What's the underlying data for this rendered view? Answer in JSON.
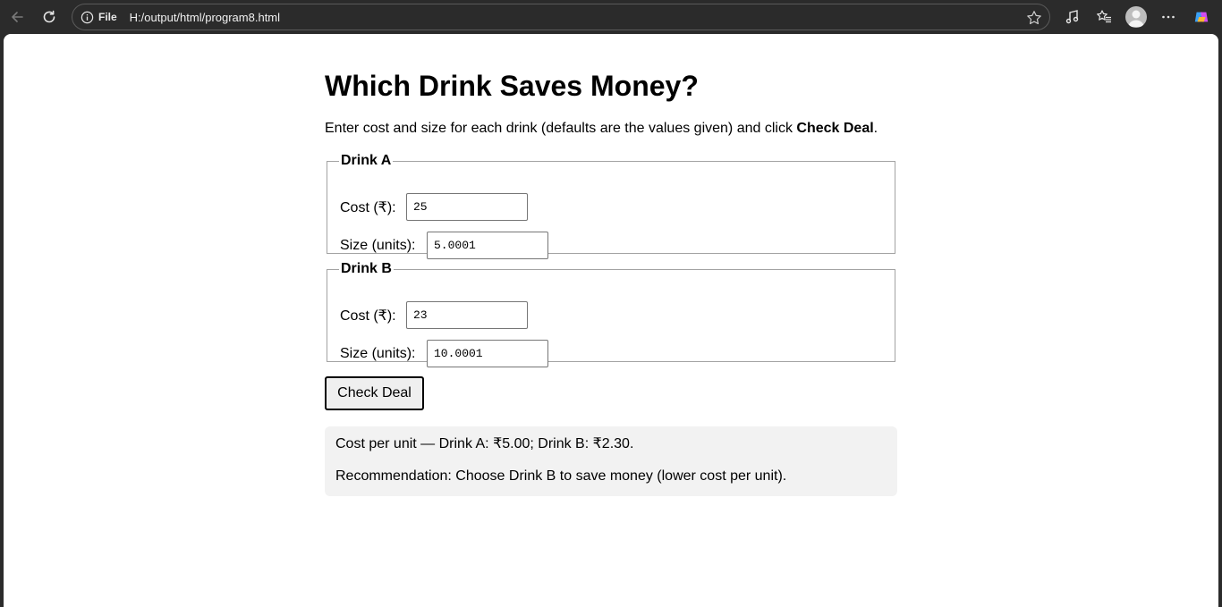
{
  "browser": {
    "scheme_label": "File",
    "url": "H:/output/html/program8.html"
  },
  "page": {
    "title": "Which Drink Saves Money?",
    "intro_prefix": "Enter cost and size for each drink (defaults are the values given) and click ",
    "intro_bold": "Check Deal",
    "intro_suffix": "."
  },
  "drinks": [
    {
      "legend": "Drink A",
      "cost_label": "Cost (₹):",
      "cost_value": "25",
      "size_label": "Size (units):",
      "size_value": "5.0001"
    },
    {
      "legend": "Drink B",
      "cost_label": "Cost (₹):",
      "cost_value": "23",
      "size_label": "Size (units):",
      "size_value": "10.0001"
    }
  ],
  "check_button_label": "Check Deal",
  "result": {
    "cost_line": "Cost per unit — Drink A: ₹5.00; Drink B: ₹2.30.",
    "recommendation": "Recommendation: Choose Drink B to save money (lower cost per unit)."
  }
}
